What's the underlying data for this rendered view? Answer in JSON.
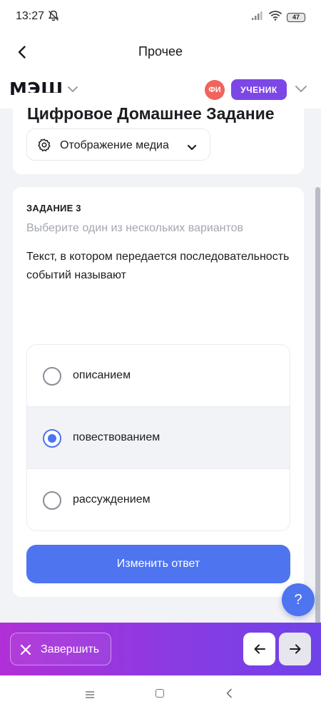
{
  "status_bar": {
    "time": "13:27",
    "battery": "47"
  },
  "header": {
    "title": "Прочее"
  },
  "mesh_bar": {
    "logo": "МЭШ",
    "avatar_initials": "ФИ",
    "role": "УЧЕНИК"
  },
  "document": {
    "title": "Цифровое Домашнее Задание",
    "media_button_label": "Отображение медиа"
  },
  "task": {
    "number_label": "ЗАДАНИЕ 3",
    "hint": "Выберите один из нескольких вариантов",
    "question": "Текст, в котором передается последовательность событий называют",
    "options": [
      {
        "label": "описанием",
        "selected": false
      },
      {
        "label": "повествованием",
        "selected": true
      },
      {
        "label": "рассуждением",
        "selected": false
      }
    ],
    "change_button_label": "Изменить ответ"
  },
  "help_button_label": "?",
  "bottom_bar": {
    "finish_label": "Завершить"
  },
  "colors": {
    "accent": "#4e74f0",
    "role_badge": "#7d47e6",
    "avatar": "#f0645c",
    "bottom_gradient_start": "#b02fd6",
    "bottom_gradient_end": "#6f43e8"
  },
  "icons": {
    "back": "chevron-left-icon",
    "gear": "gear-icon",
    "close": "close-icon",
    "prev": "arrow-left-icon",
    "next": "arrow-right-icon"
  }
}
